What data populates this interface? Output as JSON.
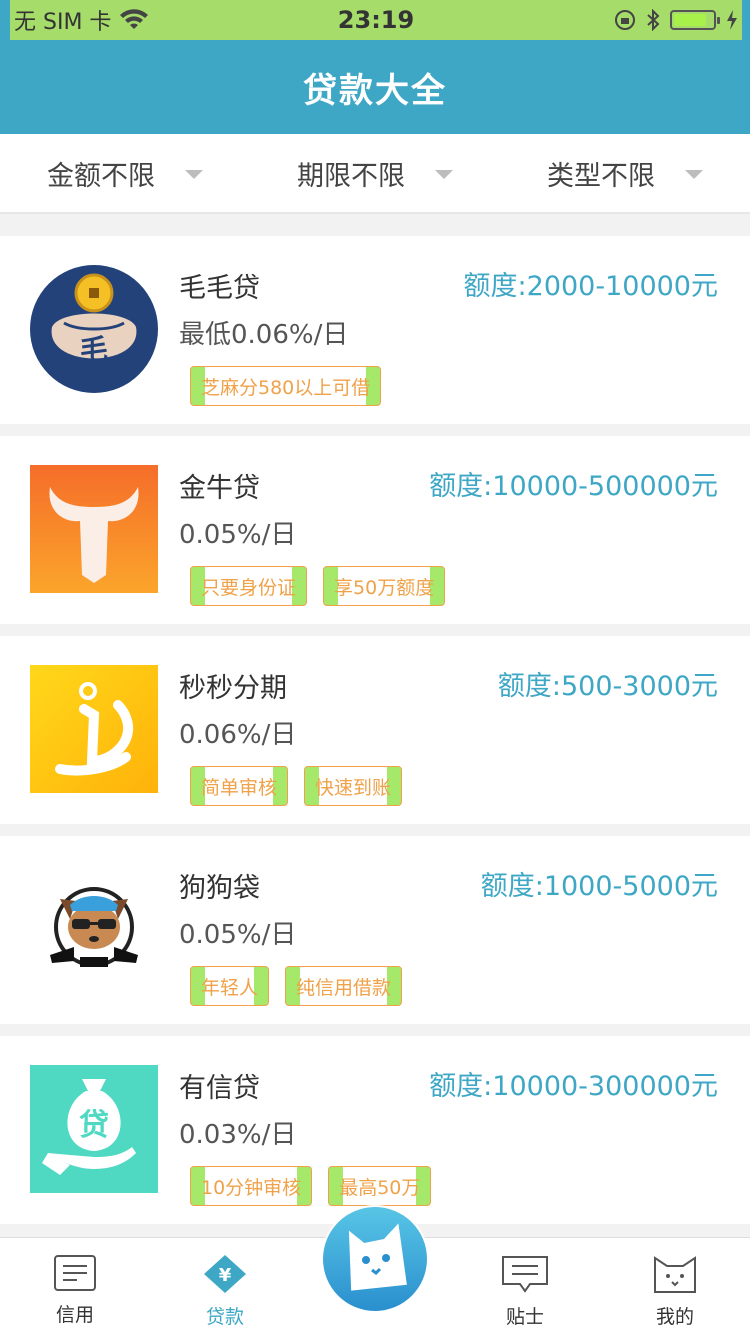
{
  "status_bar": {
    "carrier": "无 SIM 卡",
    "time": "23:19",
    "battery_level": 0.85
  },
  "header": {
    "title": "贷款大全"
  },
  "filters": [
    {
      "label": "金额不限"
    },
    {
      "label": "期限不限"
    },
    {
      "label": "类型不限"
    }
  ],
  "loans": [
    {
      "name": "毛毛贷",
      "rate": "最低0.06%/日",
      "quota": "额度:2000-10000元",
      "logo_char": "毛",
      "tags": [
        "芝麻分580以上可借"
      ]
    },
    {
      "name": "金牛贷",
      "rate": "0.05%/日",
      "quota": "额度:10000-500000元",
      "tags": [
        "只要身份证",
        "享50万额度"
      ]
    },
    {
      "name": "秒秒分期",
      "rate": "0.06%/日",
      "quota": "额度:500-3000元",
      "tags": [
        "简单审核",
        "快速到账"
      ]
    },
    {
      "name": "狗狗袋",
      "rate": "0.05%/日",
      "quota": "额度:1000-5000元",
      "tags": [
        "年轻人",
        "纯信用借款"
      ]
    },
    {
      "name": "有信贷",
      "rate": "0.03%/日",
      "quota": "额度:10000-300000元",
      "logo_char": "贷",
      "tags": [
        "10分钟审核",
        "最高50万"
      ]
    }
  ],
  "tabs": [
    {
      "label": "信用",
      "icon": "document-icon"
    },
    {
      "label": "贷款",
      "icon": "yen-icon"
    },
    {
      "label": "",
      "icon": "cat-face-icon"
    },
    {
      "label": "贴士",
      "icon": "message-icon"
    },
    {
      "label": "我的",
      "icon": "cat-outline-icon"
    }
  ],
  "colors": {
    "brand": "#3ea7c5",
    "tag": "#f0a24a"
  }
}
